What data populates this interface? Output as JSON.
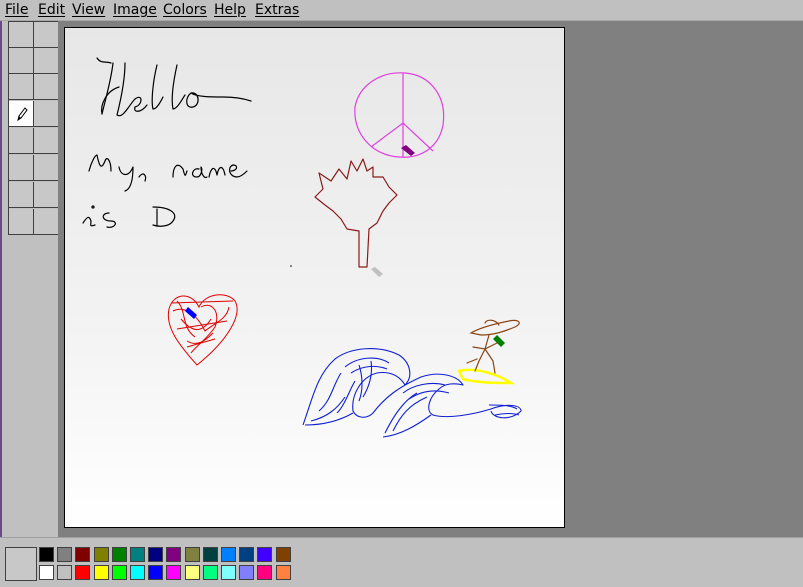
{
  "menu": {
    "items": [
      {
        "label": "File"
      },
      {
        "label": "Edit"
      },
      {
        "label": "View"
      },
      {
        "label": "Image"
      },
      {
        "label": "Colors"
      },
      {
        "label": "Help"
      },
      {
        "label": "Extras"
      }
    ]
  },
  "toolbox": {
    "active_tool": "pencil-icon"
  },
  "palette": {
    "foreground": "#000000",
    "background": "#ffffff",
    "row1": [
      "#000000",
      "#808080",
      "#800000",
      "#808000",
      "#008000",
      "#008080",
      "#000080",
      "#800080",
      "#808040",
      "#004040",
      "#0080ff",
      "#004080",
      "#4000ff",
      "#804000"
    ],
    "row2": [
      "#ffffff",
      "#c0c0c0",
      "#ff0000",
      "#ffff00",
      "#00ff00",
      "#00ffff",
      "#0000ff",
      "#ff00ff",
      "#ffff80",
      "#00ff80",
      "#80ffff",
      "#8080ff",
      "#ff0080",
      "#ff8040"
    ]
  },
  "drawing": {
    "colors": {
      "text": "#000000",
      "peace": "#e040e0",
      "leaf": "#8b1a1a",
      "heart": "#e00000",
      "wave": "#1020d0",
      "surfer": "#8b4513",
      "board": "#ffff00"
    }
  }
}
